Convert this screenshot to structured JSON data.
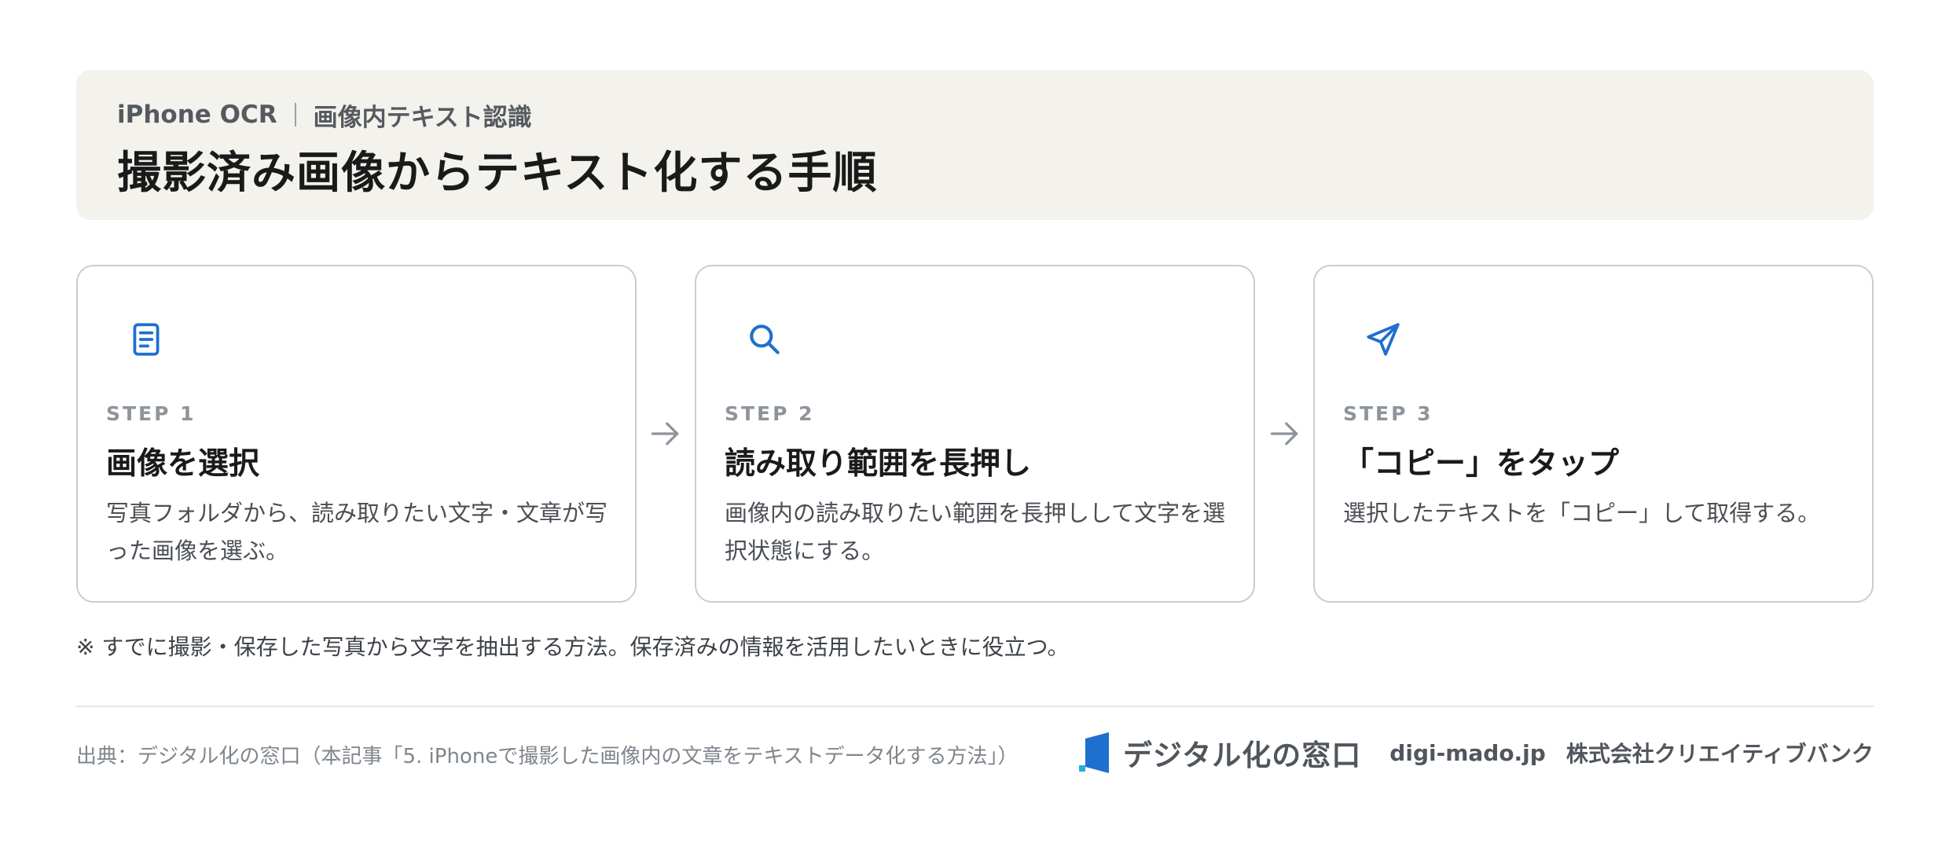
{
  "header": {
    "eyebrow_left": "iPhone OCR",
    "eyebrow_right": "画像内テキスト認識",
    "title": "撮影済み画像からテキスト化する手順"
  },
  "steps": [
    {
      "icon": "document-icon",
      "label": "STEP 1",
      "heading": "画像を選択",
      "desc": "写真フォルダから、読み取りたい文字・文章が写った画像を選ぶ。"
    },
    {
      "icon": "search-icon",
      "label": "STEP 2",
      "heading": "読み取り範囲を長押し",
      "desc": "画像内の読み取りたい範囲を長押しして文字を選択状態にする。"
    },
    {
      "icon": "send-icon",
      "label": "STEP 3",
      "heading": "「コピー」をタップ",
      "desc": "選択したテキストを「コピー」して取得する。"
    }
  ],
  "note": "※ すでに撮影・保存した写真から文字を抽出する方法。保存済みの情報を活用したいときに役立つ。",
  "footer": {
    "source": "出典：デジタル化の窓口（本記事「5. iPhoneで撮影した画像内の文章をテキストデータ化する方法」）",
    "logo_text": "デジタル化の窓口",
    "domain": "digi-mado.jp",
    "company": "株式会社クリエイティブバンク"
  },
  "colors": {
    "accent": "#1f6fcf",
    "header_bg": "#f4f2ed",
    "arrow": "#8e949b"
  }
}
